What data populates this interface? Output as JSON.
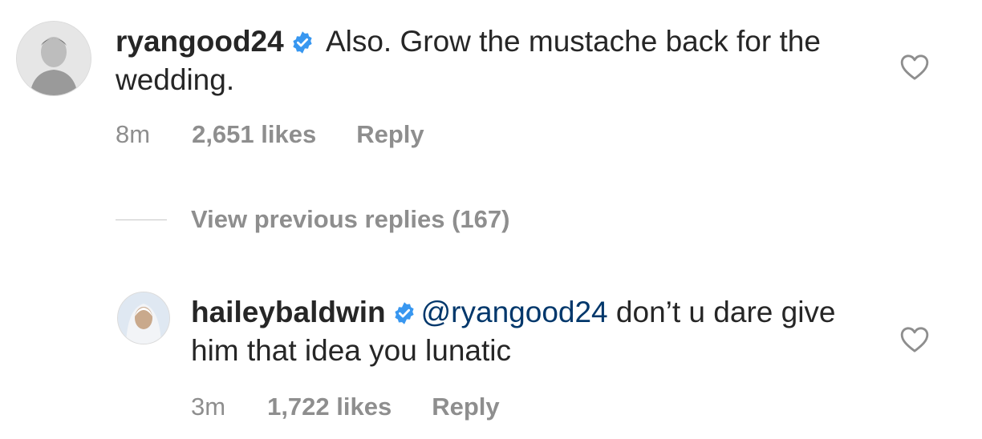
{
  "comments": [
    {
      "username": "ryangood24",
      "text": " Also. Grow the mustache back for the wedding.",
      "mention": "",
      "time": "8m",
      "likes": "2,651 likes",
      "reply_label": "Reply"
    },
    {
      "username": "haileybaldwin",
      "mention": "@ryangood24",
      "text": " don’t u dare give him that idea you lunatic",
      "time": "3m",
      "likes": "1,722 likes",
      "reply_label": "Reply"
    }
  ],
  "view_replies_label": "View previous replies (167)",
  "colors": {
    "verified": "#3897f0",
    "mention": "#00376b",
    "meta": "#8e8e8e",
    "text": "#262626"
  },
  "icons": [
    "verified-badge-icon",
    "heart-icon"
  ]
}
